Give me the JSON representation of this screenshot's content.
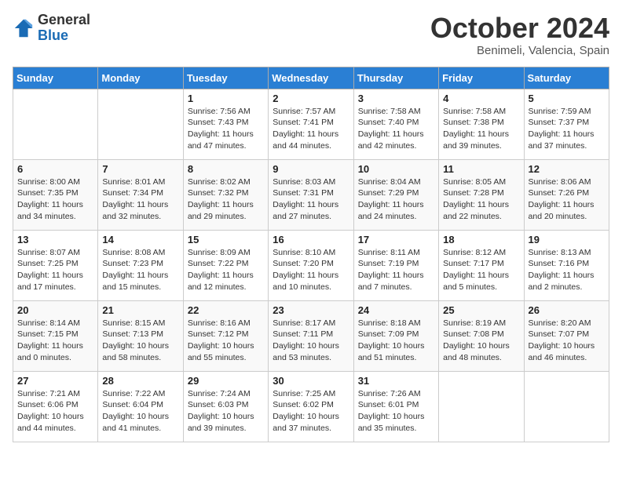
{
  "header": {
    "logo_general": "General",
    "logo_blue": "Blue",
    "month_title": "October 2024",
    "subtitle": "Benimeli, Valencia, Spain"
  },
  "weekdays": [
    "Sunday",
    "Monday",
    "Tuesday",
    "Wednesday",
    "Thursday",
    "Friday",
    "Saturday"
  ],
  "weeks": [
    [
      {
        "day": "",
        "info": ""
      },
      {
        "day": "",
        "info": ""
      },
      {
        "day": "1",
        "info": "Sunrise: 7:56 AM\nSunset: 7:43 PM\nDaylight: 11 hours and 47 minutes."
      },
      {
        "day": "2",
        "info": "Sunrise: 7:57 AM\nSunset: 7:41 PM\nDaylight: 11 hours and 44 minutes."
      },
      {
        "day": "3",
        "info": "Sunrise: 7:58 AM\nSunset: 7:40 PM\nDaylight: 11 hours and 42 minutes."
      },
      {
        "day": "4",
        "info": "Sunrise: 7:58 AM\nSunset: 7:38 PM\nDaylight: 11 hours and 39 minutes."
      },
      {
        "day": "5",
        "info": "Sunrise: 7:59 AM\nSunset: 7:37 PM\nDaylight: 11 hours and 37 minutes."
      }
    ],
    [
      {
        "day": "6",
        "info": "Sunrise: 8:00 AM\nSunset: 7:35 PM\nDaylight: 11 hours and 34 minutes."
      },
      {
        "day": "7",
        "info": "Sunrise: 8:01 AM\nSunset: 7:34 PM\nDaylight: 11 hours and 32 minutes."
      },
      {
        "day": "8",
        "info": "Sunrise: 8:02 AM\nSunset: 7:32 PM\nDaylight: 11 hours and 29 minutes."
      },
      {
        "day": "9",
        "info": "Sunrise: 8:03 AM\nSunset: 7:31 PM\nDaylight: 11 hours and 27 minutes."
      },
      {
        "day": "10",
        "info": "Sunrise: 8:04 AM\nSunset: 7:29 PM\nDaylight: 11 hours and 24 minutes."
      },
      {
        "day": "11",
        "info": "Sunrise: 8:05 AM\nSunset: 7:28 PM\nDaylight: 11 hours and 22 minutes."
      },
      {
        "day": "12",
        "info": "Sunrise: 8:06 AM\nSunset: 7:26 PM\nDaylight: 11 hours and 20 minutes."
      }
    ],
    [
      {
        "day": "13",
        "info": "Sunrise: 8:07 AM\nSunset: 7:25 PM\nDaylight: 11 hours and 17 minutes."
      },
      {
        "day": "14",
        "info": "Sunrise: 8:08 AM\nSunset: 7:23 PM\nDaylight: 11 hours and 15 minutes."
      },
      {
        "day": "15",
        "info": "Sunrise: 8:09 AM\nSunset: 7:22 PM\nDaylight: 11 hours and 12 minutes."
      },
      {
        "day": "16",
        "info": "Sunrise: 8:10 AM\nSunset: 7:20 PM\nDaylight: 11 hours and 10 minutes."
      },
      {
        "day": "17",
        "info": "Sunrise: 8:11 AM\nSunset: 7:19 PM\nDaylight: 11 hours and 7 minutes."
      },
      {
        "day": "18",
        "info": "Sunrise: 8:12 AM\nSunset: 7:17 PM\nDaylight: 11 hours and 5 minutes."
      },
      {
        "day": "19",
        "info": "Sunrise: 8:13 AM\nSunset: 7:16 PM\nDaylight: 11 hours and 2 minutes."
      }
    ],
    [
      {
        "day": "20",
        "info": "Sunrise: 8:14 AM\nSunset: 7:15 PM\nDaylight: 11 hours and 0 minutes."
      },
      {
        "day": "21",
        "info": "Sunrise: 8:15 AM\nSunset: 7:13 PM\nDaylight: 10 hours and 58 minutes."
      },
      {
        "day": "22",
        "info": "Sunrise: 8:16 AM\nSunset: 7:12 PM\nDaylight: 10 hours and 55 minutes."
      },
      {
        "day": "23",
        "info": "Sunrise: 8:17 AM\nSunset: 7:11 PM\nDaylight: 10 hours and 53 minutes."
      },
      {
        "day": "24",
        "info": "Sunrise: 8:18 AM\nSunset: 7:09 PM\nDaylight: 10 hours and 51 minutes."
      },
      {
        "day": "25",
        "info": "Sunrise: 8:19 AM\nSunset: 7:08 PM\nDaylight: 10 hours and 48 minutes."
      },
      {
        "day": "26",
        "info": "Sunrise: 8:20 AM\nSunset: 7:07 PM\nDaylight: 10 hours and 46 minutes."
      }
    ],
    [
      {
        "day": "27",
        "info": "Sunrise: 7:21 AM\nSunset: 6:06 PM\nDaylight: 10 hours and 44 minutes."
      },
      {
        "day": "28",
        "info": "Sunrise: 7:22 AM\nSunset: 6:04 PM\nDaylight: 10 hours and 41 minutes."
      },
      {
        "day": "29",
        "info": "Sunrise: 7:24 AM\nSunset: 6:03 PM\nDaylight: 10 hours and 39 minutes."
      },
      {
        "day": "30",
        "info": "Sunrise: 7:25 AM\nSunset: 6:02 PM\nDaylight: 10 hours and 37 minutes."
      },
      {
        "day": "31",
        "info": "Sunrise: 7:26 AM\nSunset: 6:01 PM\nDaylight: 10 hours and 35 minutes."
      },
      {
        "day": "",
        "info": ""
      },
      {
        "day": "",
        "info": ""
      }
    ]
  ]
}
